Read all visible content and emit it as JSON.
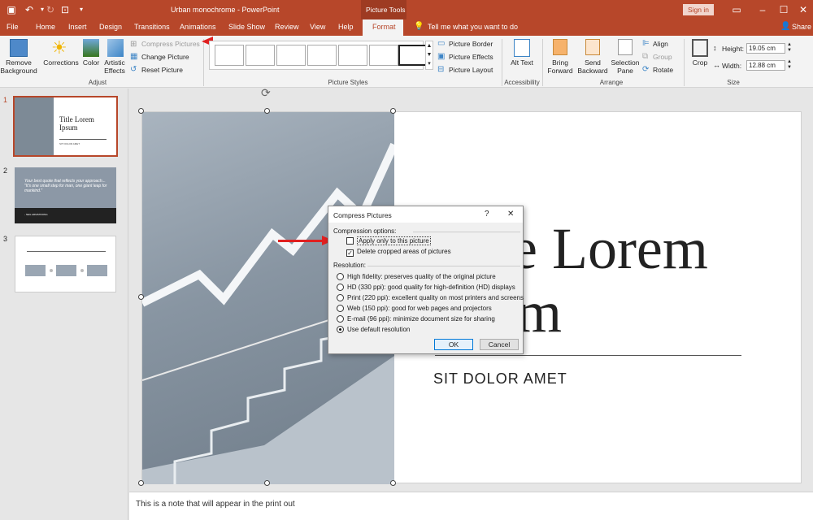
{
  "titlebar": {
    "title": "Urban monochrome  -  PowerPoint",
    "context_tab": "Picture Tools",
    "sign_in": "Sign in"
  },
  "tabs": [
    "File",
    "Home",
    "Insert",
    "Design",
    "Transitions",
    "Animations",
    "Slide Show",
    "Review",
    "View",
    "Help",
    "Format"
  ],
  "tell_me": "Tell me what you want to do",
  "share": "Share",
  "ribbon": {
    "remove_bg": "Remove Background",
    "corrections": "Corrections",
    "color": "Color",
    "artistic": "Artistic Effects",
    "compress": "Compress Pictures",
    "change": "Change Picture",
    "reset": "Reset Picture",
    "adjust": "Adjust",
    "border": "Picture Border",
    "effects": "Picture Effects",
    "layout": "Picture Layout",
    "styles": "Picture Styles",
    "alt_text": "Alt Text",
    "accessibility": "Accessibility",
    "bring": "Bring Forward",
    "send": "Send Backward",
    "selection": "Selection Pane",
    "align": "Align",
    "group": "Group",
    "rotate": "Rotate",
    "arrange": "Arrange",
    "crop": "Crop",
    "height_label": "Height:",
    "height": "19.05 cm",
    "width_label": "Width:",
    "width": "12.88 cm",
    "size": "Size"
  },
  "slides": [
    {
      "num": "1",
      "title": "Title Lorem Ipsum",
      "sub": "SIT DOLOR AMET"
    },
    {
      "num": "2",
      "quote": "Your best quote that reflects your approach... \"It's one small step for man, one giant leap for mankind.\"",
      "name": "- NEIL ARMSTRONG"
    },
    {
      "num": "3"
    }
  ],
  "slide": {
    "title_line1": "e Lorem",
    "title_line2": "um",
    "subtitle": "SIT DOLOR AMET"
  },
  "dialog": {
    "title": "Compress Pictures",
    "help": "?",
    "close": "✕",
    "compression_label": "Compression options:",
    "apply_only": "Apply only to this picture",
    "delete_cropped": "Delete cropped areas of pictures",
    "resolution_label": "Resolution:",
    "options": [
      "High fidelity: preserves quality of the original picture",
      "HD (330 ppi): good quality for high-definition (HD) displays",
      "Print (220 ppi): excellent quality on most printers and screens",
      "Web (150 ppi): good for web pages and projectors",
      "E-mail (96 ppi): minimize document size for sharing",
      "Use default resolution"
    ],
    "ok": "OK",
    "cancel": "Cancel"
  },
  "notes": "This is a note that will appear in the print out",
  "colors": {
    "accent": "#b7472a",
    "arrow": "#e02020"
  }
}
